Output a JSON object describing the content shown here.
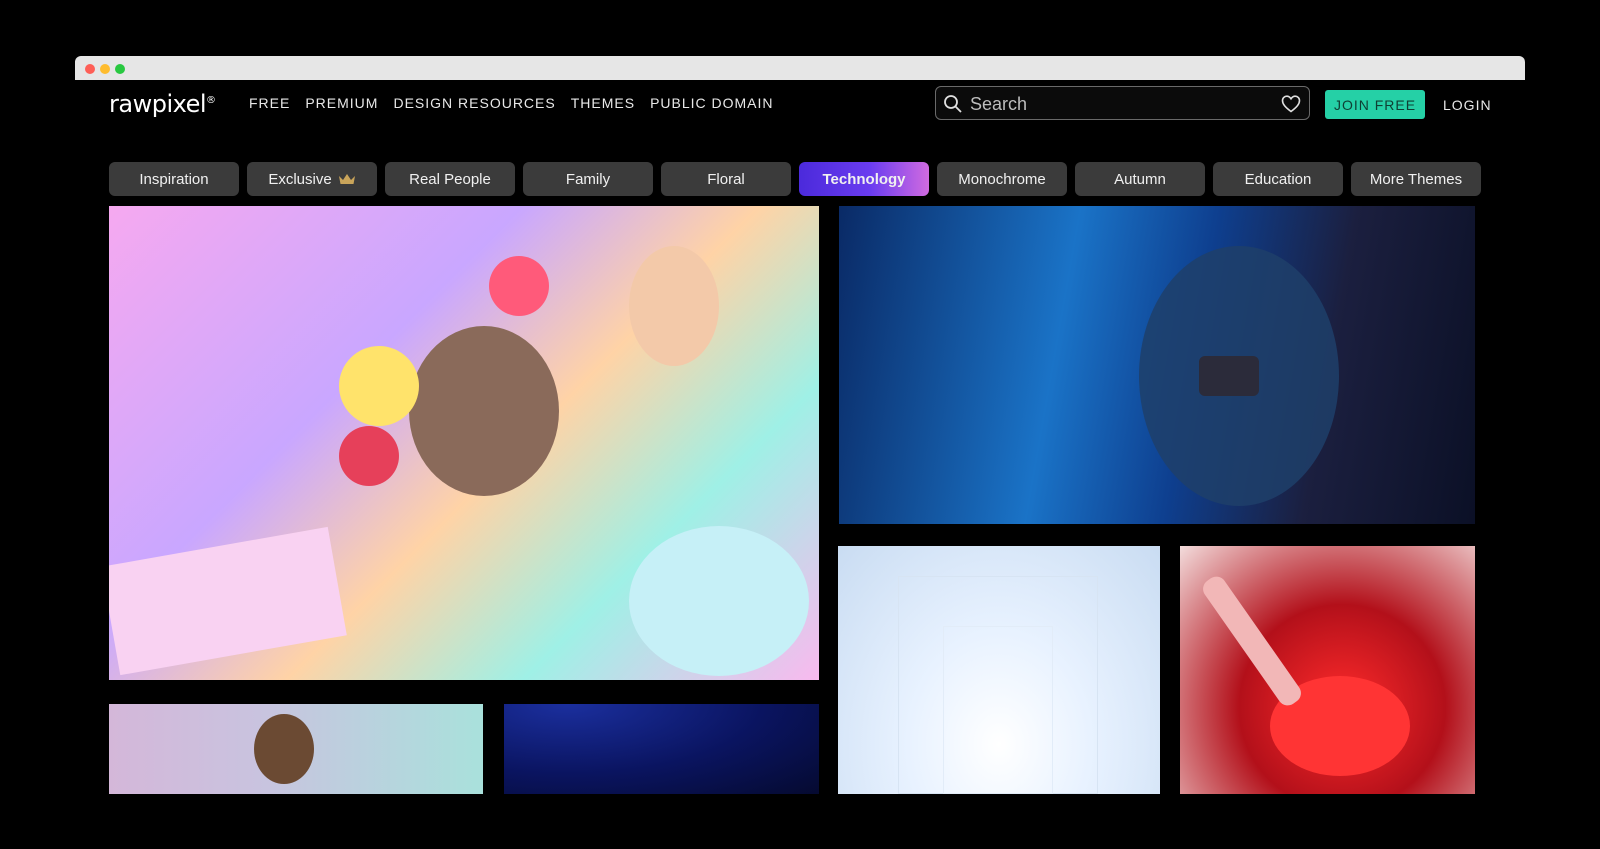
{
  "brand": {
    "logo_text": "rawpixel",
    "logo_mark": "®"
  },
  "nav": {
    "items": [
      "FREE",
      "PREMIUM",
      "DESIGN RESOURCES",
      "THEMES",
      "PUBLIC DOMAIN"
    ]
  },
  "search": {
    "placeholder": "Search",
    "value": ""
  },
  "actions": {
    "join_label": "JOIN FREE",
    "login_label": "LOGIN"
  },
  "colors": {
    "accent_join": "#25d0a6",
    "active_pill_start": "#4b2adb",
    "active_pill_end": "#d16be0",
    "pill_bg": "#3b3b3b"
  },
  "themes": {
    "items": [
      {
        "label": "Inspiration",
        "active": false
      },
      {
        "label": "Exclusive",
        "active": false,
        "icon": "crown-icon"
      },
      {
        "label": "Real People",
        "active": false
      },
      {
        "label": "Family",
        "active": false
      },
      {
        "label": "Floral",
        "active": false
      },
      {
        "label": "Technology",
        "active": true
      },
      {
        "label": "Monochrome",
        "active": false
      },
      {
        "label": "Autumn",
        "active": false
      },
      {
        "label": "Education",
        "active": false
      },
      {
        "label": "More Themes",
        "active": false
      }
    ]
  },
  "gallery": {
    "tiles": [
      {
        "name": "illustration-social-media-tile"
      },
      {
        "name": "person-with-phone-blue-tile"
      },
      {
        "name": "white-corridor-tile"
      },
      {
        "name": "red-rose-glass-tile"
      },
      {
        "name": "woman-bob-haircut-tile"
      },
      {
        "name": "blue-dotted-abstract-tile"
      }
    ]
  }
}
